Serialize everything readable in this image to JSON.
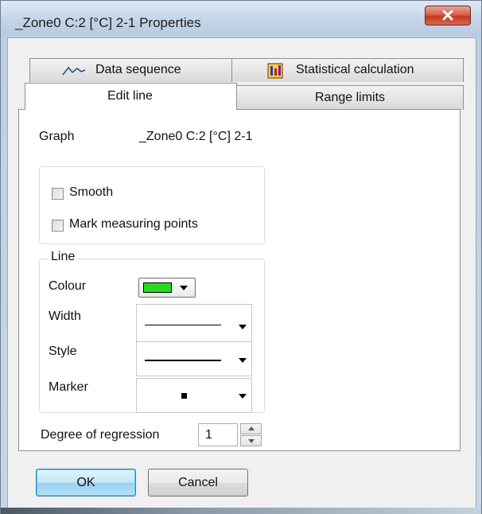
{
  "window": {
    "title": "_Zone0 C:2 [°C] 2-1 Properties"
  },
  "tabs": [
    {
      "label": "Data sequence",
      "icon": "line-graph-icon"
    },
    {
      "label": "Statistical calculation",
      "icon": "statistics-icon"
    },
    {
      "label": "Edit line",
      "icon": null,
      "active": true
    },
    {
      "label": "Range limits",
      "icon": null
    }
  ],
  "edit_line": {
    "graph_label": "Graph",
    "graph_value": "_Zone0 C:2 [°C] 2-1",
    "smooth_label": "Smooth",
    "smooth_checked": false,
    "mark_points_label": "Mark measuring points",
    "mark_points_checked": false,
    "line_group_label": "Line",
    "colour_label": "Colour",
    "colour_value": "#22dd22",
    "width_label": "Width",
    "style_label": "Style",
    "marker_label": "Marker",
    "regression_label": "Degree of regression",
    "regression_value": "1"
  },
  "buttons": {
    "ok": "OK",
    "cancel": "Cancel"
  }
}
